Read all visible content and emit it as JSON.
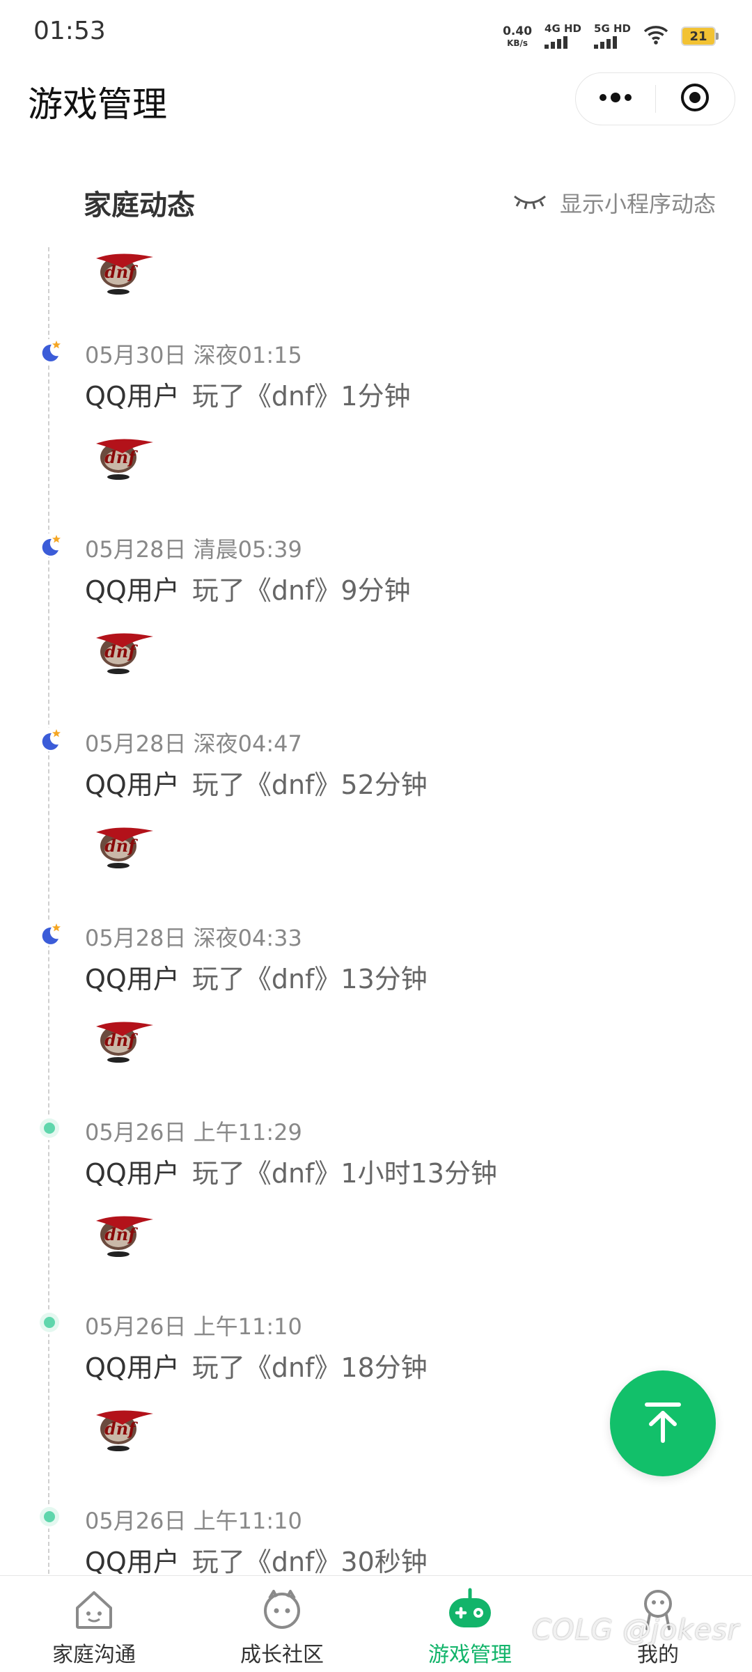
{
  "status_bar": {
    "time": "01:53",
    "net_speed_value": "0.40",
    "net_speed_unit": "KB/s",
    "signal_1_label": "4G HD",
    "signal_2_label": "5G HD",
    "battery_level": "21"
  },
  "nav": {
    "title": "游戏管理"
  },
  "section": {
    "title": "家庭动态",
    "toggle_label": "显示小程序动态"
  },
  "feed": {
    "user_name": "QQ用户",
    "items": [
      {
        "time": "05月30日 深夜01:15",
        "user": "QQ用户",
        "activity": "玩了《dnf》1分钟",
        "period_icon": "moon-icon"
      },
      {
        "time": "05月28日 清晨05:39",
        "user": "QQ用户",
        "activity": "玩了《dnf》9分钟",
        "period_icon": "moon-icon"
      },
      {
        "time": "05月28日 深夜04:47",
        "user": "QQ用户",
        "activity": "玩了《dnf》52分钟",
        "period_icon": "moon-icon"
      },
      {
        "time": "05月28日 深夜04:33",
        "user": "QQ用户",
        "activity": "玩了《dnf》13分钟",
        "period_icon": "moon-icon"
      },
      {
        "time": "05月26日 上午11:29",
        "user": "QQ用户",
        "activity": "玩了《dnf》1小时13分钟",
        "period_icon": "day-dot-icon"
      },
      {
        "time": "05月26日 上午11:10",
        "user": "QQ用户",
        "activity": "玩了《dnf》18分钟",
        "period_icon": "day-dot-icon"
      },
      {
        "time": "05月26日 上午11:10",
        "user": "QQ用户",
        "activity": "玩了《dnf》30秒钟",
        "period_icon": "day-dot-icon"
      }
    ]
  },
  "tabs": [
    {
      "label": "家庭沟通",
      "icon": "home-chat-icon",
      "active": false
    },
    {
      "label": "成长社区",
      "icon": "community-face-icon",
      "active": false
    },
    {
      "label": "游戏管理",
      "icon": "gamepad-icon",
      "active": true
    },
    {
      "label": "我的",
      "icon": "profile-icon",
      "active": false
    }
  ],
  "colors": {
    "accent": "#12c06a",
    "active_tab": "#12b46a",
    "timeline_day_dot": "#5fd6ac",
    "moon": "#3b5cd8",
    "star": "#f5a623"
  },
  "watermark": "COLG @jokesr"
}
